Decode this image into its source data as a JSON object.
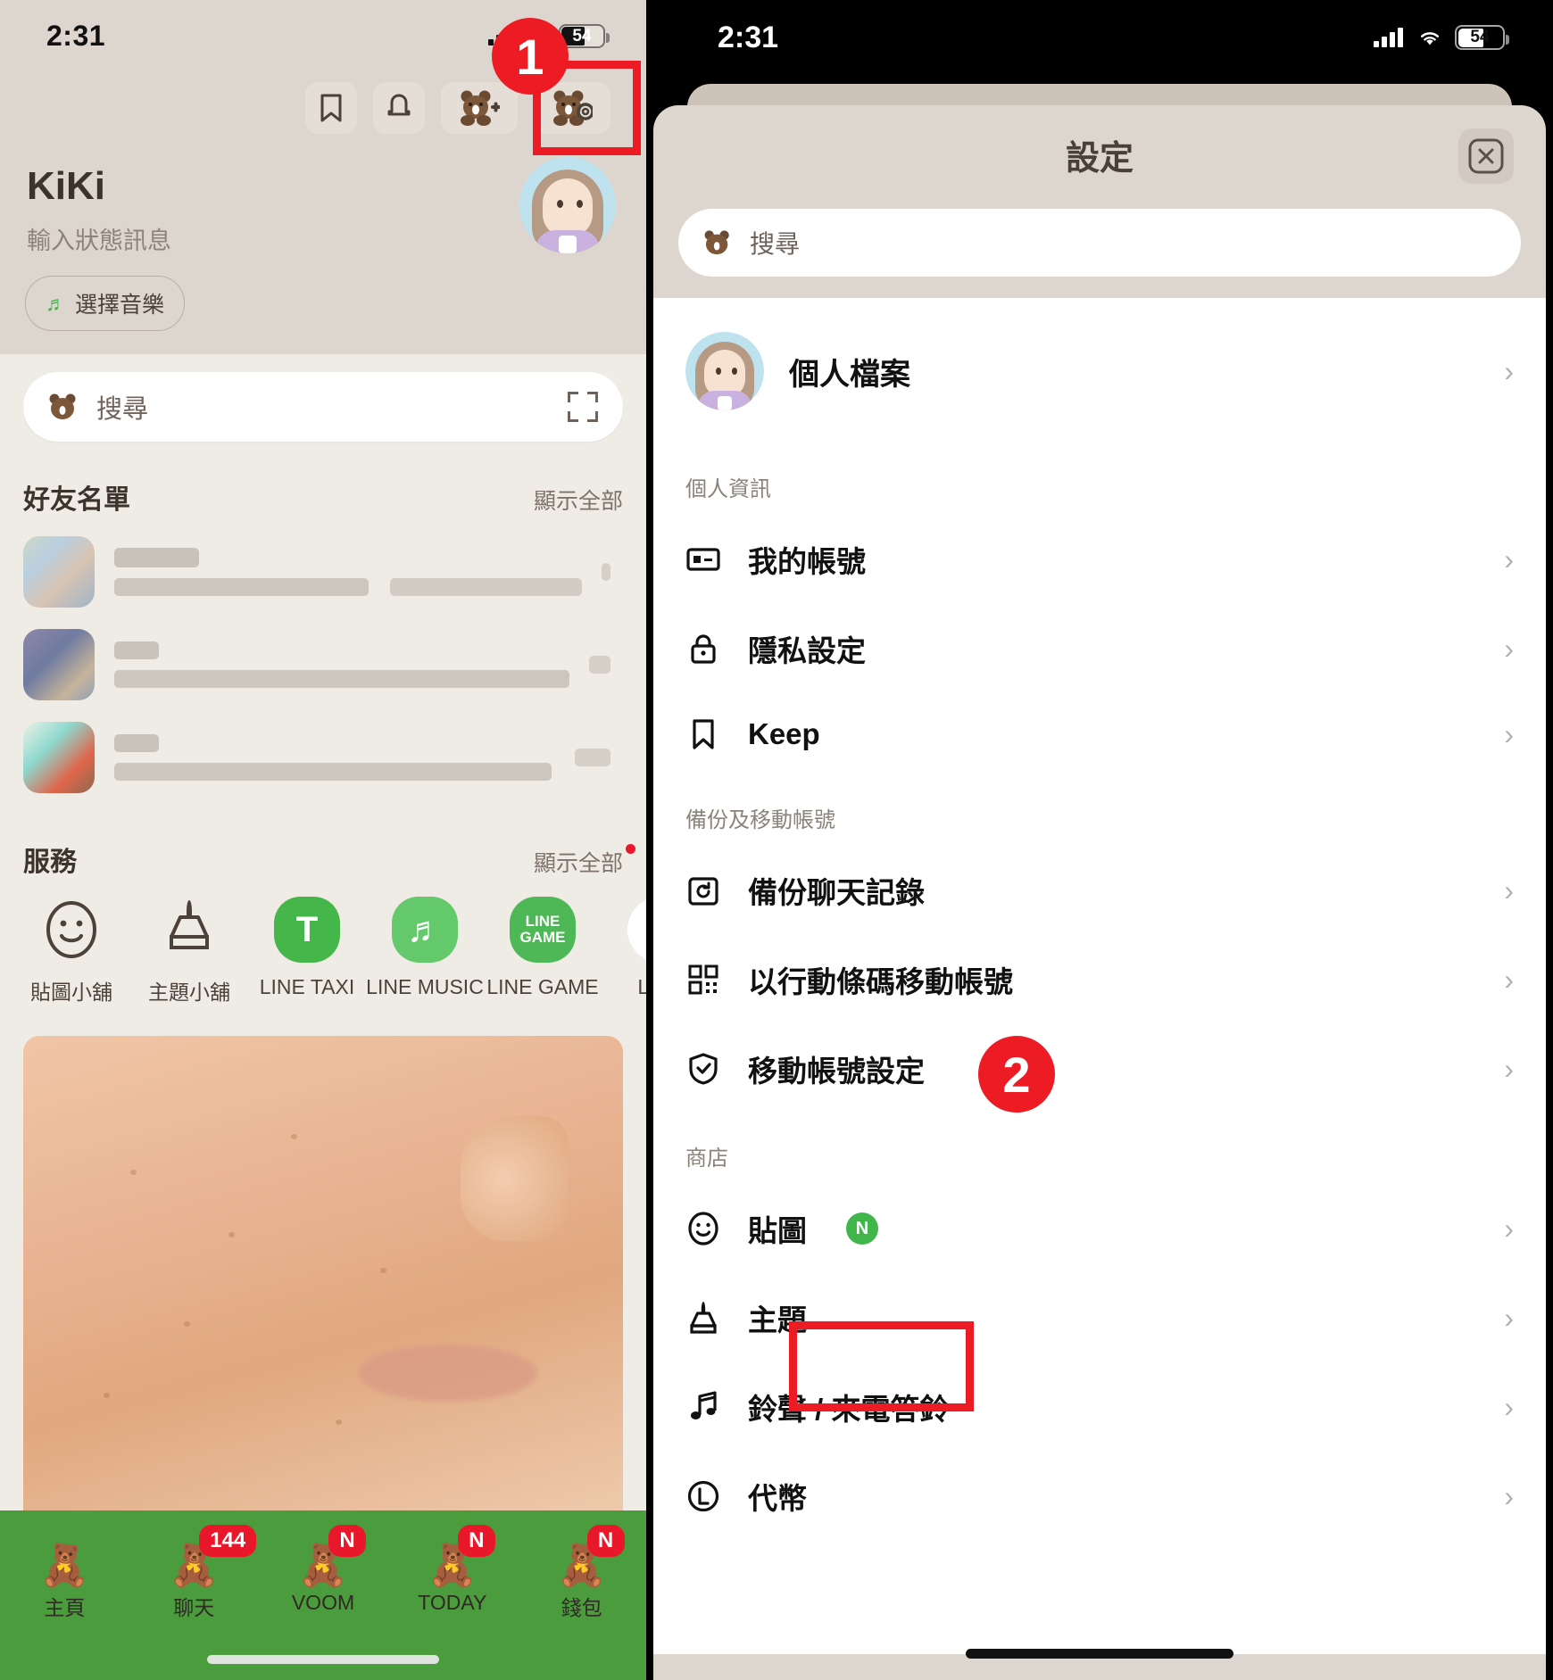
{
  "left": {
    "status": {
      "time": "2:31",
      "battery": "54"
    },
    "toolbar": [
      {
        "name": "keep-bookmark",
        "icon": "bookmark-icon"
      },
      {
        "name": "notifications",
        "icon": "bell-icon"
      },
      {
        "name": "add-friend",
        "icon": "bear-plus-icon"
      },
      {
        "name": "settings",
        "icon": "bear-gear-icon"
      }
    ],
    "profile": {
      "name": "KiKi",
      "status_message": "輸入狀態訊息",
      "music_button": "選擇音樂"
    },
    "search": {
      "placeholder": "搜尋",
      "scan_icon": "scan-icon"
    },
    "friends": {
      "title": "好友名單",
      "show_all": "顯示全部",
      "rows": [
        {
          "name_w": 95,
          "line_w": 285,
          "line2_w": 215,
          "right_w": 40
        },
        {
          "name_w": 50,
          "line_w": 510,
          "right_w": 40
        },
        {
          "name_w": 50,
          "line_w": 490,
          "right_w": 40
        }
      ]
    },
    "services": {
      "title": "服務",
      "show_all": "顯示全部",
      "items": [
        {
          "label": "貼圖小舖",
          "icon": "sticker-face-icon",
          "style": "outline"
        },
        {
          "label": "主題小舖",
          "icon": "brush-icon",
          "style": "outline"
        },
        {
          "label": "LINE TAXI",
          "icon": "taxi-t-icon",
          "style": "green",
          "glyph": "T"
        },
        {
          "label": "LINE MUSIC",
          "icon": "music-note-icon",
          "style": "green",
          "glyph": "♪"
        },
        {
          "label": "LINE GAME",
          "icon": "line-game-icon",
          "style": "green",
          "glyph": "LINE\nGAME"
        },
        {
          "label": "LINE",
          "icon": "line-play-icon",
          "style": "green",
          "glyph": "▶"
        }
      ]
    },
    "tabbar": [
      {
        "label": "主頁",
        "badge": ""
      },
      {
        "label": "聊天",
        "badge": "144"
      },
      {
        "label": "VOOM",
        "badge": "N"
      },
      {
        "label": "TODAY",
        "badge": "N"
      },
      {
        "label": "錢包",
        "badge": "N"
      }
    ]
  },
  "right": {
    "status": {
      "time": "2:31",
      "battery": "54"
    },
    "header": {
      "title": "設定",
      "close_icon": "close-icon"
    },
    "search": {
      "placeholder": "搜尋"
    },
    "profile_row": {
      "label": "個人檔案"
    },
    "groups": [
      {
        "title": "個人資訊",
        "items": [
          {
            "label": "我的帳號",
            "icon": "id-card-icon",
            "badge": ""
          },
          {
            "label": "隱私設定",
            "icon": "lock-icon",
            "badge": ""
          },
          {
            "label": "Keep",
            "icon": "bookmark-icon",
            "badge": ""
          }
        ]
      },
      {
        "title": "備份及移動帳號",
        "items": [
          {
            "label": "備份聊天記錄",
            "icon": "backup-folder-icon",
            "badge": ""
          },
          {
            "label": "以行動條碼移動帳號",
            "icon": "qr-code-icon",
            "badge": ""
          },
          {
            "label": "移動帳號設定",
            "icon": "shield-check-icon",
            "badge": ""
          }
        ]
      },
      {
        "title": "商店",
        "items": [
          {
            "label": "貼圖",
            "icon": "sticker-face-icon",
            "badge": "N"
          },
          {
            "label": "主題",
            "icon": "brush-icon",
            "badge": ""
          },
          {
            "label": "鈴聲 / 來電答鈴",
            "icon": "music-note-icon",
            "badge": ""
          },
          {
            "label": "代幣",
            "icon": "coin-l-icon",
            "badge": ""
          }
        ]
      }
    ]
  },
  "callouts": [
    {
      "number": "1"
    },
    {
      "number": "2"
    }
  ],
  "colors": {
    "accent_red": "#ed1c24",
    "line_green": "#3fb54a",
    "badge_red": "#e8172a",
    "panel_bg": "#efece6",
    "header_bg": "#ddd6ce"
  }
}
